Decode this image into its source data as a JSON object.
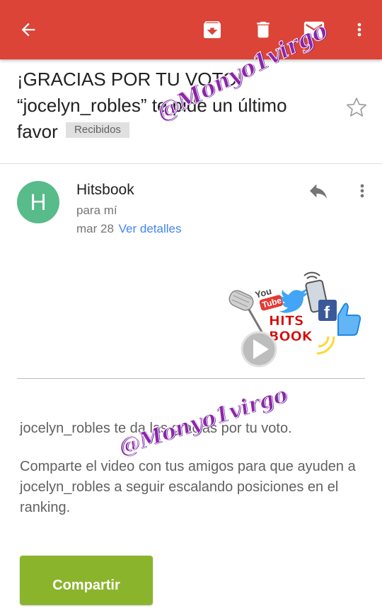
{
  "app_bar": {
    "color": "#db4437",
    "icons": [
      "back-arrow-icon",
      "archive-icon",
      "trash-icon",
      "mail-icon",
      "more-vert-icon"
    ]
  },
  "email": {
    "subject": "¡GRACIAS POR TU VOTO! “jocelyn_robles” te pide un último favor",
    "label": "Recibidos",
    "sender": {
      "initial": "H",
      "name": "Hitsbook",
      "to": "para mí",
      "date": "mar 28",
      "details_link": "Ver detalles"
    },
    "logo": {
      "brand": "HITS BOOK",
      "youtube_you": "You",
      "youtube_tube": "Tube"
    },
    "body": {
      "paragraph1": "jocelyn_robles te da las gracias por tu voto.",
      "paragraph2": "Comparte el video con tus amigos para que ayuden a jocelyn_robles a seguir escalando posiciones en el ranking."
    },
    "share_button": "Compartir"
  },
  "watermarks": [
    "@Monyo1virgo",
    "@Monyo1virgo"
  ]
}
